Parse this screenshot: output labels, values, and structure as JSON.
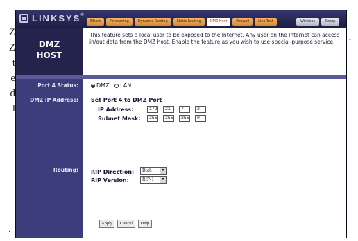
{
  "document": {
    "left_fragments": [
      "Z",
      "Z",
      "t",
      "e",
      "d",
      "l"
    ],
    "right_fragment": "·",
    "bottom_fragment": "·"
  },
  "header": {
    "logo": "LINKSYS",
    "logo_mark": "®",
    "tabs": [
      "Filters",
      "Forwarding",
      "Dynamic Routing",
      "Static Routing",
      "DMZ Host",
      "Firewall",
      "Link Test"
    ],
    "active_tab": "DMZ Host",
    "right_tabs": [
      "Wireless",
      "Setup"
    ]
  },
  "title": {
    "line1": "DMZ",
    "line2": "HOST"
  },
  "description": "This feature sets a local user to be exposed to the Internet. Any user on the Internet can access in/out data from the DMZ host. Enable the feature as you wish to use special-purpose service.",
  "port4_status": {
    "label": "Port 4 Status:",
    "option_dmz": "DMZ",
    "option_lan": "LAN",
    "selected": "DMZ"
  },
  "dmz_ip": {
    "label": "DMZ IP Address:",
    "heading": "Set Port 4 to DMZ Port",
    "ip_label": "IP Address:",
    "ip": [
      "172",
      "21",
      "7",
      "2"
    ],
    "mask_label": "Subnet Mask:",
    "mask": [
      "255",
      "255",
      "255",
      "0"
    ]
  },
  "routing": {
    "label": "Routing:",
    "direction_label": "RIP Direction:",
    "direction_value": "Both",
    "version_label": "RIP Version:",
    "version_value": "RIP-1",
    "arrow": "▼"
  },
  "buttons": {
    "apply": "Apply",
    "cancel": "Cancel",
    "help": "Help"
  }
}
